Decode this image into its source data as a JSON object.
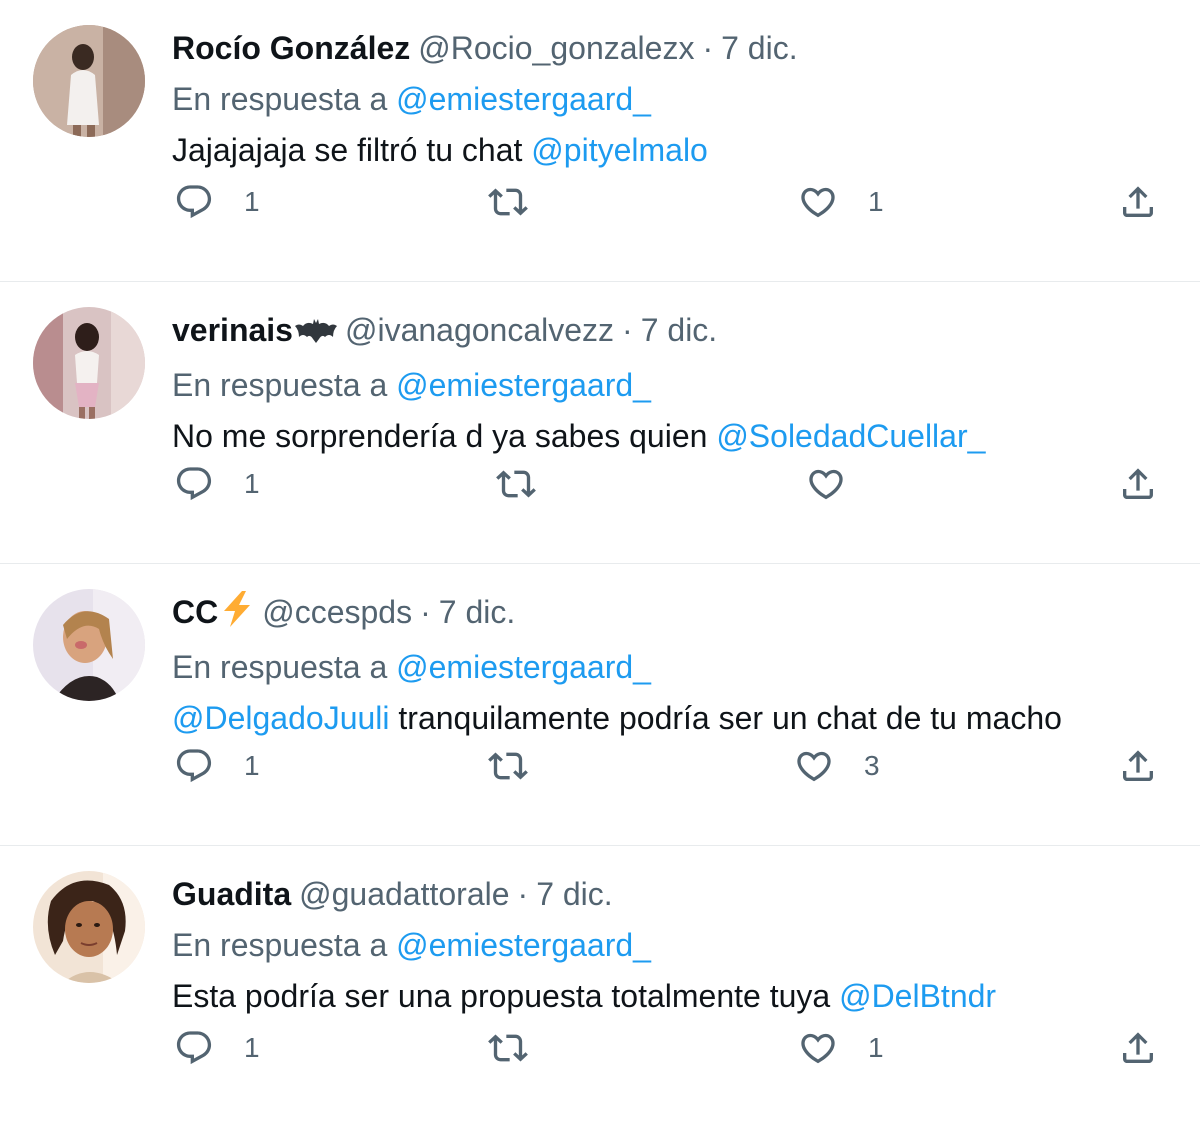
{
  "colors": {
    "text_primary": "#0f1419",
    "text_secondary": "#536471",
    "link": "#1d9bf0",
    "divider": "#e8ebed"
  },
  "icons": {
    "reply": "speech-bubble-icon",
    "retweet": "retweet-arrows-icon",
    "like": "heart-icon",
    "share": "share-upload-icon"
  },
  "tweets": [
    {
      "display_name": "Rocío González",
      "name_emoji": "",
      "handle": "@Rocio_gonzalezx",
      "separator": "·",
      "date": "7 dic.",
      "reply_prefix": "En respuesta a",
      "reply_to": "@emiestergaard_",
      "body_pre": "",
      "body_mention_start": "",
      "body_text": "Jajajajaja se filtró tu chat ",
      "body_mention_end": "@pityelmalo",
      "reply_count": "1",
      "retweet_count": "",
      "like_count": "1"
    },
    {
      "display_name": "verinais",
      "name_emoji": "bat-emoji",
      "handle": "@ivanagoncalvezz",
      "separator": "·",
      "date": "7 dic.",
      "reply_prefix": "En respuesta a",
      "reply_to": "@emiestergaard_",
      "body_pre": "",
      "body_mention_start": "",
      "body_text": "No me sorprendería d ya sabes quien ",
      "body_mention_end": "@SoledadCuellar_",
      "reply_count": "1",
      "retweet_count": "",
      "like_count": ""
    },
    {
      "display_name": "CC",
      "name_emoji": "lightning-emoji",
      "handle": "@ccespds",
      "separator": "·",
      "date": "7 dic.",
      "reply_prefix": "En respuesta a",
      "reply_to": "@emiestergaard_",
      "body_pre": "",
      "body_mention_start": "@DelgadoJuuli",
      "body_text": " tranquilamente podría ser un chat de tu macho",
      "body_mention_end": "",
      "reply_count": "1",
      "retweet_count": "",
      "like_count": "3"
    },
    {
      "display_name": "Guadita",
      "name_emoji": "",
      "handle": "@guadattorale",
      "separator": "·",
      "date": "7 dic.",
      "reply_prefix": "En respuesta a",
      "reply_to": "@emiestergaard_",
      "body_pre": "",
      "body_mention_start": "",
      "body_text": "Esta podría ser una propuesta totalmente tuya ",
      "body_mention_end": "@DelBtndr",
      "reply_count": "1",
      "retweet_count": "",
      "like_count": "1"
    }
  ]
}
